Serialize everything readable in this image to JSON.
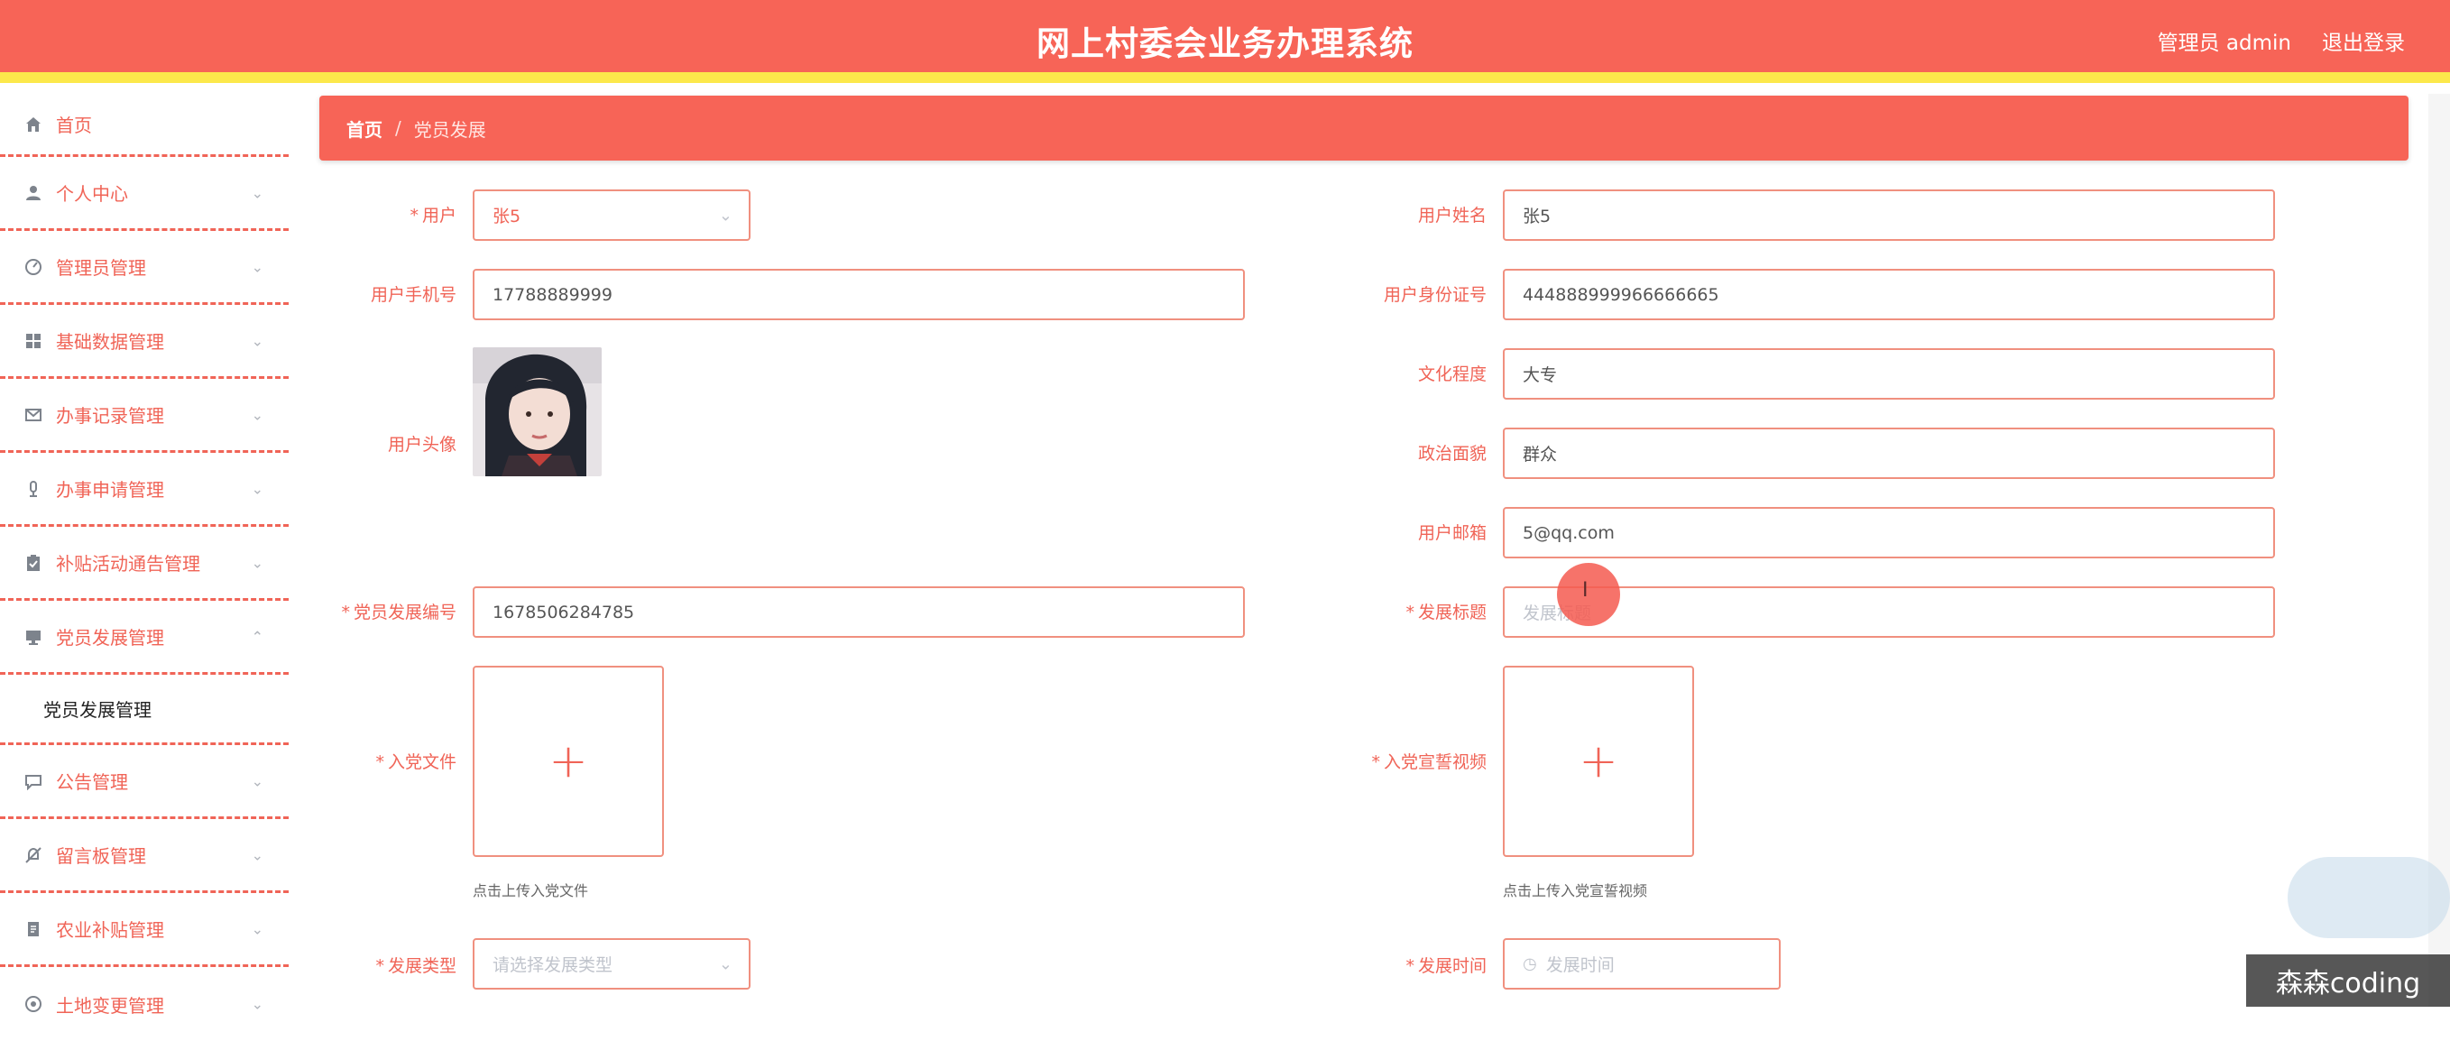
{
  "header": {
    "title": "网上村委会业务办理系统",
    "user": "管理员 admin",
    "logout": "退出登录"
  },
  "sidebar": {
    "items": [
      {
        "label": "首页",
        "icon": "home-icon"
      },
      {
        "label": "个人中心",
        "icon": "user-icon"
      },
      {
        "label": "管理员管理",
        "icon": "dashboard-icon"
      },
      {
        "label": "基础数据管理",
        "icon": "grid-icon"
      },
      {
        "label": "办事记录管理",
        "icon": "mail-icon"
      },
      {
        "label": "办事申请管理",
        "icon": "mic-icon"
      },
      {
        "label": "补贴活动通告管理",
        "icon": "clipboard-icon"
      },
      {
        "label": "党员发展管理",
        "icon": "monitor-icon"
      },
      {
        "label": "公告管理",
        "icon": "chat-icon"
      },
      {
        "label": "留言板管理",
        "icon": "bell-off-icon"
      },
      {
        "label": "农业补贴管理",
        "icon": "document-icon"
      },
      {
        "label": "土地变更管理",
        "icon": "compass-icon"
      }
    ],
    "sub_item": "党员发展管理"
  },
  "breadcrumb": {
    "home": "首页",
    "sep": "/",
    "current": "党员发展"
  },
  "form": {
    "user_label": "用户",
    "user_value": "张5",
    "name_label": "用户姓名",
    "name_value": "张5",
    "phone_label": "用户手机号",
    "phone_value": "17788889999",
    "id_label": "用户身份证号",
    "id_value": "444888999966666665",
    "avatar_label": "用户头像",
    "edu_label": "文化程度",
    "edu_value": "大专",
    "politics_label": "政治面貌",
    "politics_value": "群众",
    "email_label": "用户邮箱",
    "email_value": "5@qq.com",
    "code_label": "党员发展编号",
    "code_value": "1678506284785",
    "title_label": "发展标题",
    "title_placeholder": "发展标题",
    "file_label": "入党文件",
    "file_hint": "点击上传入党文件",
    "video_label": "入党宣誓视频",
    "video_hint": "点击上传入党宣誓视频",
    "type_label": "发展类型",
    "type_placeholder": "请选择发展类型",
    "time_label": "发展时间",
    "time_placeholder": "发展时间",
    "plus": "+"
  },
  "watermark": "森森coding",
  "colors": {
    "primary": "#f76457",
    "accent_yellow": "#fce84b",
    "border": "#f0907f"
  }
}
